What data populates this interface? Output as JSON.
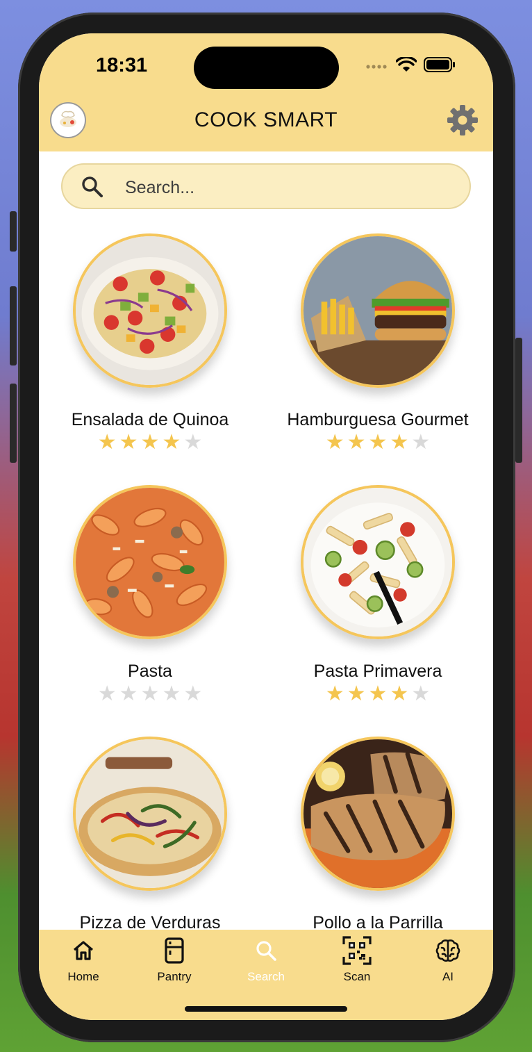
{
  "status_bar": {
    "time": "18:31"
  },
  "header": {
    "title": "COOK SMART",
    "avatar_icon": "chef-avatar-icon",
    "settings_icon": "gear-icon"
  },
  "search": {
    "placeholder": "Search...",
    "value": ""
  },
  "recipes": [
    {
      "name": "Ensalada de Quinoa",
      "rating": 4,
      "rating_max": 5
    },
    {
      "name": "Hamburguesa Gourmet",
      "rating": 4,
      "rating_max": 5
    },
    {
      "name": "Pasta",
      "rating": 0,
      "rating_max": 5
    },
    {
      "name": "Pasta Primavera",
      "rating": 4,
      "rating_max": 5
    },
    {
      "name": "Pizza de Verduras",
      "rating": null,
      "rating_max": 5
    },
    {
      "name": "Pollo a la Parrilla",
      "rating": null,
      "rating_max": 5
    }
  ],
  "tabbar": {
    "items": [
      {
        "label": "Home",
        "icon": "home-icon"
      },
      {
        "label": "Pantry",
        "icon": "fridge-icon"
      },
      {
        "label": "Search",
        "icon": "search-icon",
        "active": true
      },
      {
        "label": "Scan",
        "icon": "qr-scan-icon"
      },
      {
        "label": "AI",
        "icon": "brain-icon"
      }
    ]
  },
  "colors": {
    "header_bg": "#f8dc8d",
    "accent_gold": "#f5c65c",
    "star_on": "#f4c54e",
    "star_off": "#d9d9d9",
    "search_bg": "#fbeec2"
  }
}
